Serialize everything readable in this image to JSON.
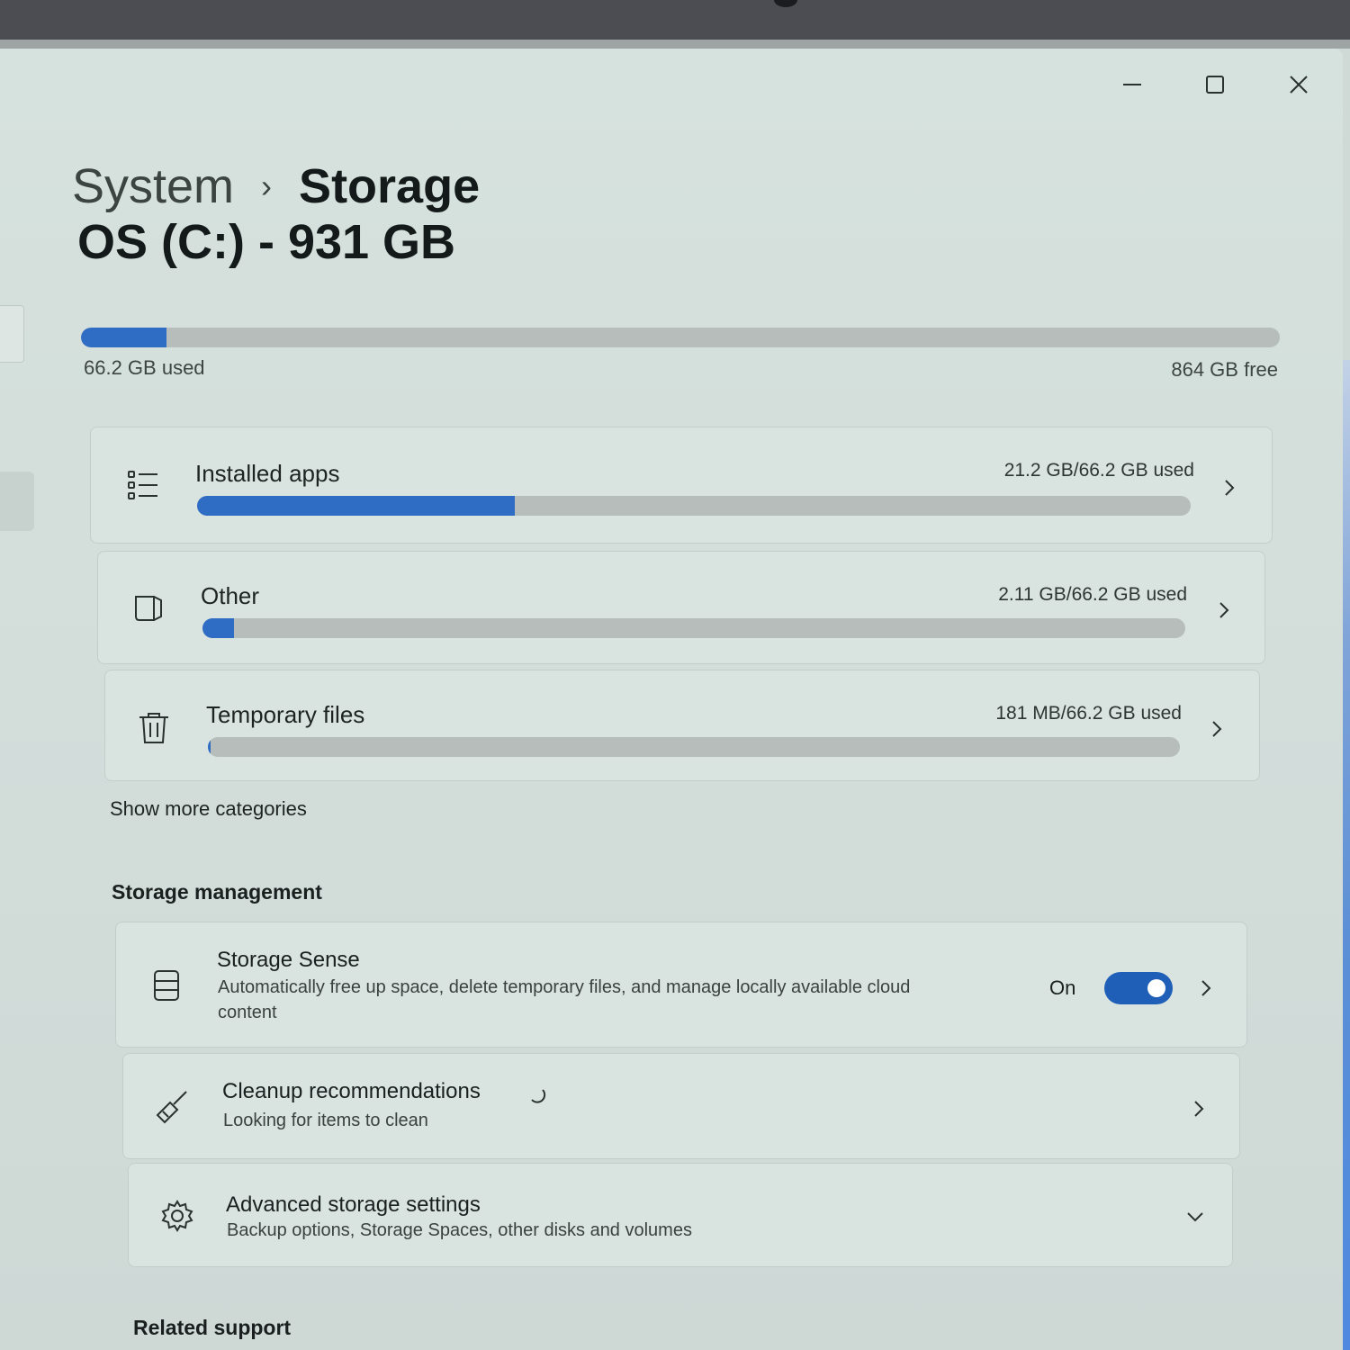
{
  "window": {
    "controls": {
      "minimize": "minimize-icon",
      "maximize": "maximize-icon",
      "close": "close-icon"
    }
  },
  "breadcrumb": {
    "parent": "System",
    "separator": "›",
    "current": "Storage"
  },
  "drive": {
    "title": "OS (C:) - 931 GB",
    "used_label": "66.2 GB used",
    "free_label": "864 GB free",
    "used_fraction": 0.071
  },
  "categories": [
    {
      "label": "Installed apps",
      "amount": "21.2 GB/66.2 GB used",
      "fraction": 0.32,
      "icon": "list-icon"
    },
    {
      "label": "Other",
      "amount": "2.11 GB/66.2 GB used",
      "fraction": 0.032,
      "icon": "document-icon"
    },
    {
      "label": "Temporary files",
      "amount": "181 MB/66.2 GB used",
      "fraction": 0.0027,
      "icon": "trash-icon"
    }
  ],
  "show_more": "Show more categories",
  "storage_management": {
    "heading": "Storage management",
    "storage_sense": {
      "title": "Storage Sense",
      "desc_line1": "Automatically free up space, delete temporary files, and manage locally available cloud",
      "desc_line2": "content",
      "state": "On",
      "enabled": true,
      "icon": "storage-drive-icon"
    },
    "cleanup": {
      "title": "Cleanup recommendations",
      "desc": "Looking for items to clean",
      "icon": "broom-icon"
    },
    "advanced": {
      "title": "Advanced storage settings",
      "desc": "Backup options, Storage Spaces, other disks and volumes",
      "icon": "gear-icon"
    }
  },
  "related_support": {
    "heading": "Related support"
  },
  "colors": {
    "accent": "#2f6cc4",
    "toggle_on": "#1f5fb8",
    "bar_track": "#b6bdbb"
  }
}
